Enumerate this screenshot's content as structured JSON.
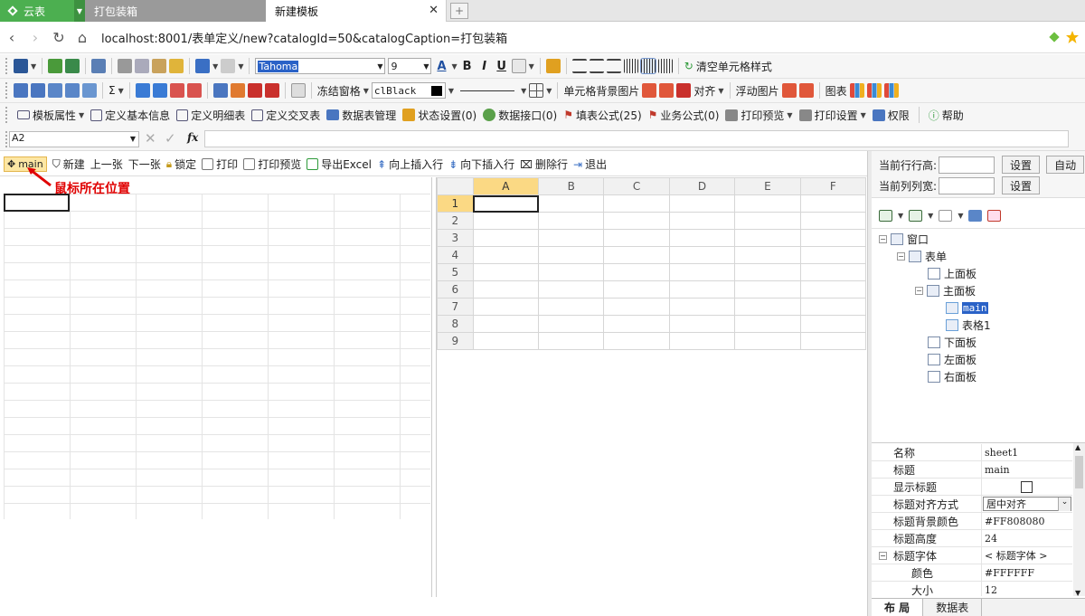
{
  "browser": {
    "app_tab": "云表",
    "tabs": [
      {
        "label": "打包装箱"
      },
      {
        "label": "新建模板"
      }
    ],
    "url": "localhost:8001/表单定义/new?catalogId=50&catalogCaption=打包装箱"
  },
  "toolbar1": {
    "font_name": "Tahoma",
    "font_size": "9",
    "bold": "B",
    "italic": "I",
    "underline": "U",
    "clear_style": "清空单元格样式"
  },
  "toolbar2": {
    "freeze": "冻结窗格",
    "color_value": "clBlack",
    "cell_bg_image": "单元格背景图片",
    "align": "对齐",
    "float_image": "浮动图片",
    "chart": "图表"
  },
  "toolbar3": {
    "items": [
      {
        "label": "模板属性"
      },
      {
        "label": "定义基本信息"
      },
      {
        "label": "定义明细表"
      },
      {
        "label": "定义交叉表"
      },
      {
        "label": "数据表管理"
      },
      {
        "label": "状态设置(0)"
      },
      {
        "label": "数据接口(0)"
      },
      {
        "label": "填表公式(25)"
      },
      {
        "label": "业务公式(0)"
      },
      {
        "label": "打印预览"
      },
      {
        "label": "打印设置"
      },
      {
        "label": "权限"
      },
      {
        "label": "帮助"
      }
    ]
  },
  "formula": {
    "cell_ref": "A2",
    "fx": "fx"
  },
  "form_toolbar": {
    "main_label": "main",
    "items": [
      {
        "label": "新建"
      },
      {
        "label": "上一张"
      },
      {
        "label": "下一张"
      },
      {
        "label": "锁定"
      },
      {
        "label": "打印"
      },
      {
        "label": "打印预览"
      },
      {
        "label": "导出Excel"
      },
      {
        "label": "向上插入行"
      },
      {
        "label": "向下插入行"
      },
      {
        "label": "删除行"
      },
      {
        "label": "退出"
      }
    ]
  },
  "annotation": "鼠标所在位置",
  "sheet": {
    "columns": [
      "A",
      "B",
      "C",
      "D",
      "E",
      "F"
    ],
    "rows": [
      "1",
      "2",
      "3",
      "4",
      "5",
      "6",
      "7",
      "8",
      "9"
    ]
  },
  "rowcol": {
    "row_height_label": "当前行行高:",
    "col_width_label": "当前列列宽:",
    "set": "设置",
    "auto": "自动"
  },
  "tree": {
    "nodes": [
      {
        "label": "窗口"
      },
      {
        "label": "表单"
      },
      {
        "label": "上面板"
      },
      {
        "label": "主面板"
      },
      {
        "label": "main"
      },
      {
        "label": "表格1"
      },
      {
        "label": "下面板"
      },
      {
        "label": "左面板"
      },
      {
        "label": "右面板"
      }
    ]
  },
  "props": {
    "rows": [
      {
        "key": "名称",
        "value": "sheet1"
      },
      {
        "key": "标题",
        "value": "main"
      },
      {
        "key": "显示标题",
        "value": ""
      },
      {
        "key": "标题对齐方式",
        "value": "居中对齐"
      },
      {
        "key": "标题背景颜色",
        "value": "#FF808080"
      },
      {
        "key": "标题高度",
        "value": "24"
      },
      {
        "key": "标题字体",
        "value": "< 标题字体 >"
      },
      {
        "key": "颜色",
        "value": "#FFFFFF"
      },
      {
        "key": "大小",
        "value": "12"
      }
    ]
  },
  "bottom_tabs": [
    {
      "label": "布 局"
    },
    {
      "label": "数据表"
    }
  ],
  "colors": {
    "accent": "#4caf50",
    "highlight": "#2a62c7",
    "annotation": "#e00000"
  }
}
